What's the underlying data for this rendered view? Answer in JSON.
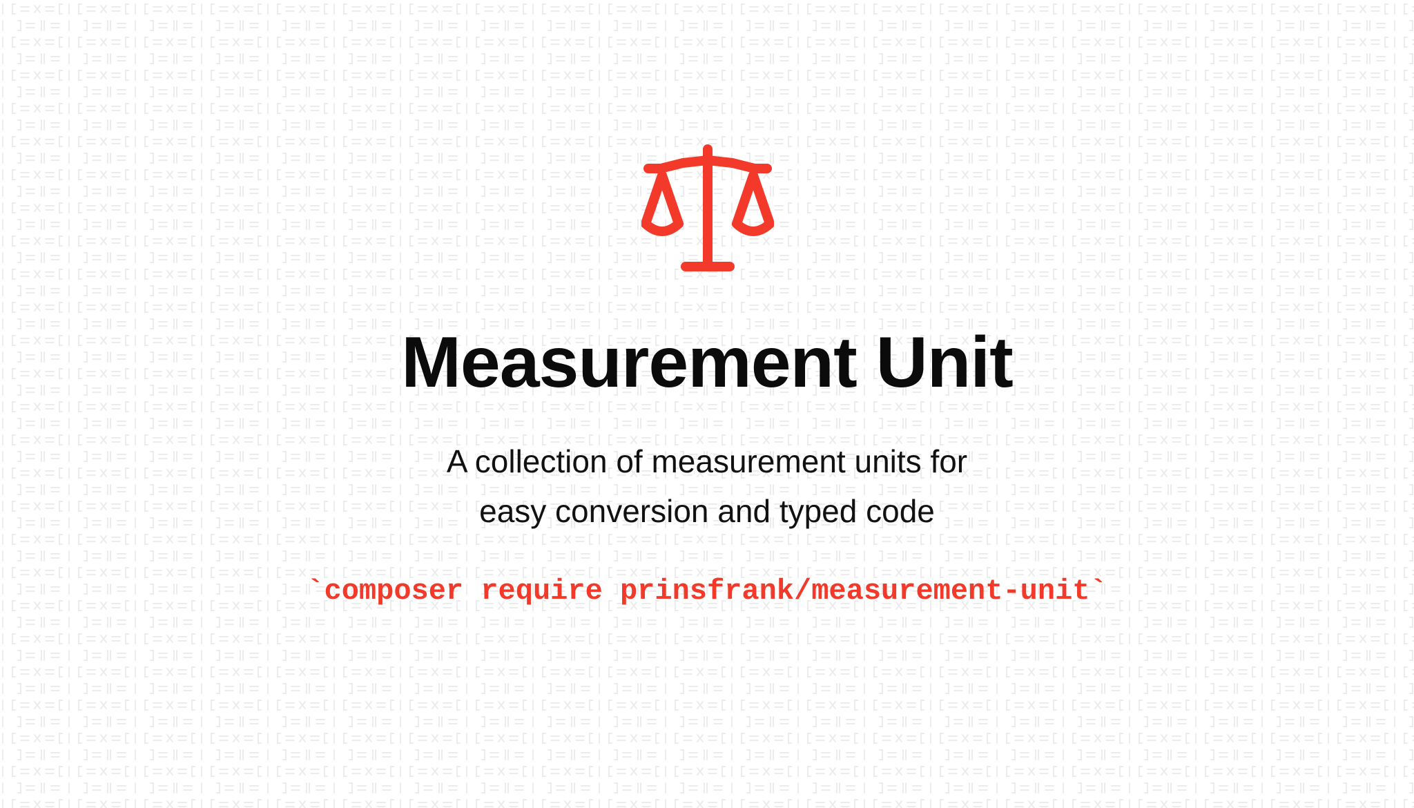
{
  "brand": {
    "accent_color": "#f33a2a",
    "text_color": "#0b0b0b",
    "background_color": "#ffffff",
    "logo_icon": "scale-balance-icon"
  },
  "hero": {
    "title": "Measurement Unit",
    "subtitle_line1": "A collection of measurement units for",
    "subtitle_line2": "easy conversion and typed code",
    "install_command": "`composer require prinsfrank/measurement-unit`"
  }
}
